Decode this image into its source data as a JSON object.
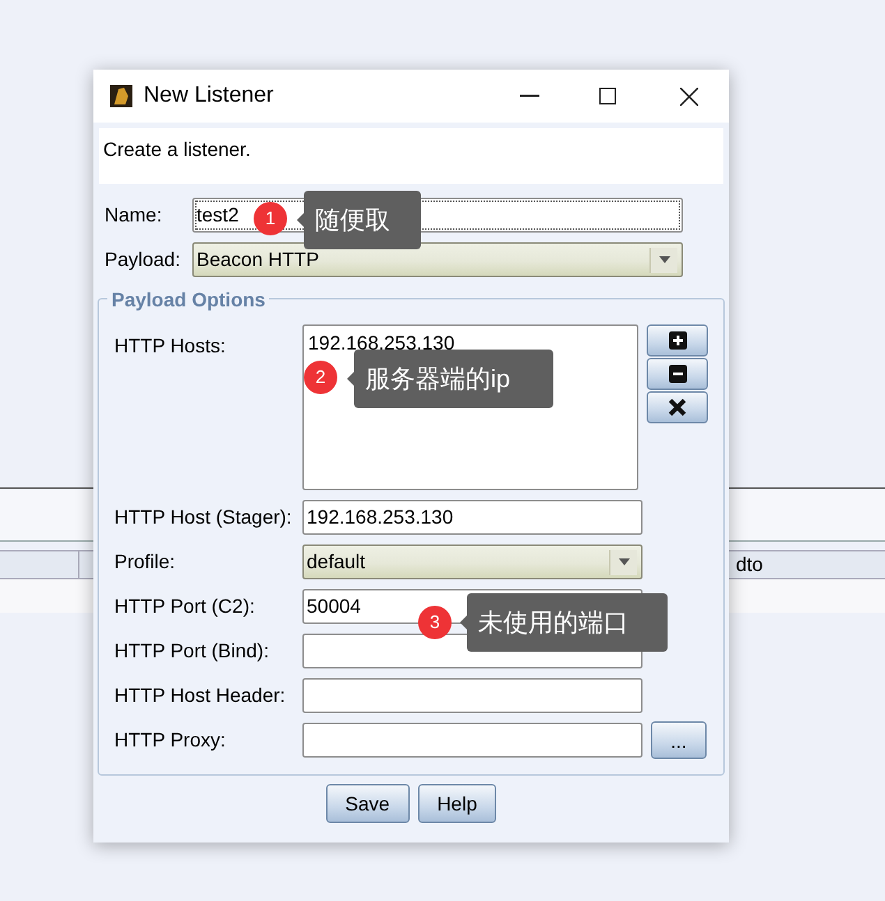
{
  "background_table": {
    "columns": [
      "dto"
    ]
  },
  "window": {
    "title": "New Listener",
    "description": "Create a listener."
  },
  "name": {
    "label": "Name:",
    "value": "test2"
  },
  "payload": {
    "label": "Payload:",
    "value": "Beacon HTTP"
  },
  "payload_options": {
    "title": "Payload Options",
    "hosts_label": "HTTP Hosts:",
    "hosts": [
      "192.168.253.130"
    ],
    "fields": [
      {
        "kind": "text",
        "label": "HTTP Host (Stager):",
        "value": "192.168.253.130"
      },
      {
        "kind": "select",
        "label": "Profile:",
        "value": "default"
      },
      {
        "kind": "text",
        "label": "HTTP Port (C2):",
        "value": "50004"
      },
      {
        "kind": "text",
        "label": "HTTP Port (Bind):"
      },
      {
        "kind": "text",
        "label": "HTTP Host Header:"
      },
      {
        "kind": "proxy",
        "label": "HTTP Proxy:",
        "button": "..."
      }
    ]
  },
  "buttons": [
    "Save",
    "Help"
  ],
  "annotations": [
    {
      "number": "1",
      "text": "随便取"
    },
    {
      "number": "2",
      "text": "服务器端的ip"
    },
    {
      "number": "3",
      "text": "未使用的端口"
    }
  ]
}
